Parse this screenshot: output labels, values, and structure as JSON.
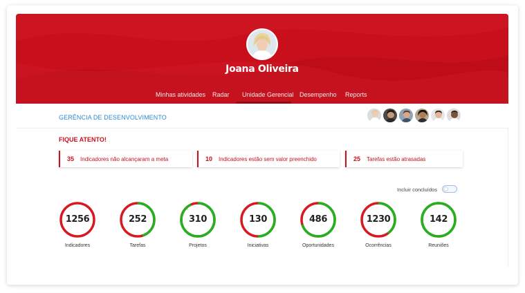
{
  "user": {
    "name": "Joana Oliveira",
    "avatar_icon": "user-avatar-icon"
  },
  "nav": {
    "items": [
      {
        "label": "Minhas atividades"
      },
      {
        "label": "Radar"
      },
      {
        "label": "Unidade Gerencial"
      },
      {
        "label": "Desempenho"
      },
      {
        "label": "Reports"
      }
    ],
    "active": "Unidade Gerencial"
  },
  "department": {
    "title": "GERÊNCIA DE DESENVOLVIMENTO"
  },
  "team": {
    "members_icon": "team-member-avatar-icon",
    "count": 6
  },
  "attention": {
    "title": "FIQUE ATENTO!",
    "alerts": [
      {
        "count": "35",
        "text": "Indicadores não alcançaram a meta"
      },
      {
        "count": "10",
        "text": "Indicadores estão sem valor preenchido"
      },
      {
        "count": "25",
        "text": "Tarefas estão atrasadas"
      }
    ]
  },
  "toggle": {
    "label": "Incluir concluídos",
    "checked": false
  },
  "metrics": [
    {
      "value": "1256",
      "label": "Indicadores",
      "green_fraction": 0.0
    },
    {
      "value": "252",
      "label": "Tarefas",
      "green_fraction": 0.45
    },
    {
      "value": "310",
      "label": "Projetos",
      "green_fraction": 0.93
    },
    {
      "value": "130",
      "label": "Iniciativas",
      "green_fraction": 0.5
    },
    {
      "value": "486",
      "label": "Oportunidades",
      "green_fraction": 0.7
    },
    {
      "value": "1230",
      "label": "Ocorrências",
      "green_fraction": 0.4
    },
    {
      "value": "142",
      "label": "Reuniões",
      "green_fraction": 1.0
    }
  ],
  "colors": {
    "brand_red": "#c80f1c",
    "ring_red": "#d71a21",
    "ring_green": "#22b21f",
    "link_blue": "#2a8ad6"
  }
}
